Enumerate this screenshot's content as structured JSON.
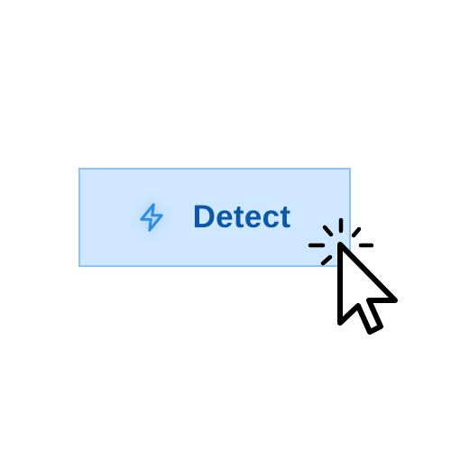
{
  "button": {
    "label": "Detect",
    "icon": "lightning-bolt-icon",
    "background_color": "#cfe7ff",
    "border_color": "#8fc2f2",
    "text_color": "#0b57a8"
  },
  "cursor": {
    "icon": "pointer-click-cursor-icon"
  }
}
